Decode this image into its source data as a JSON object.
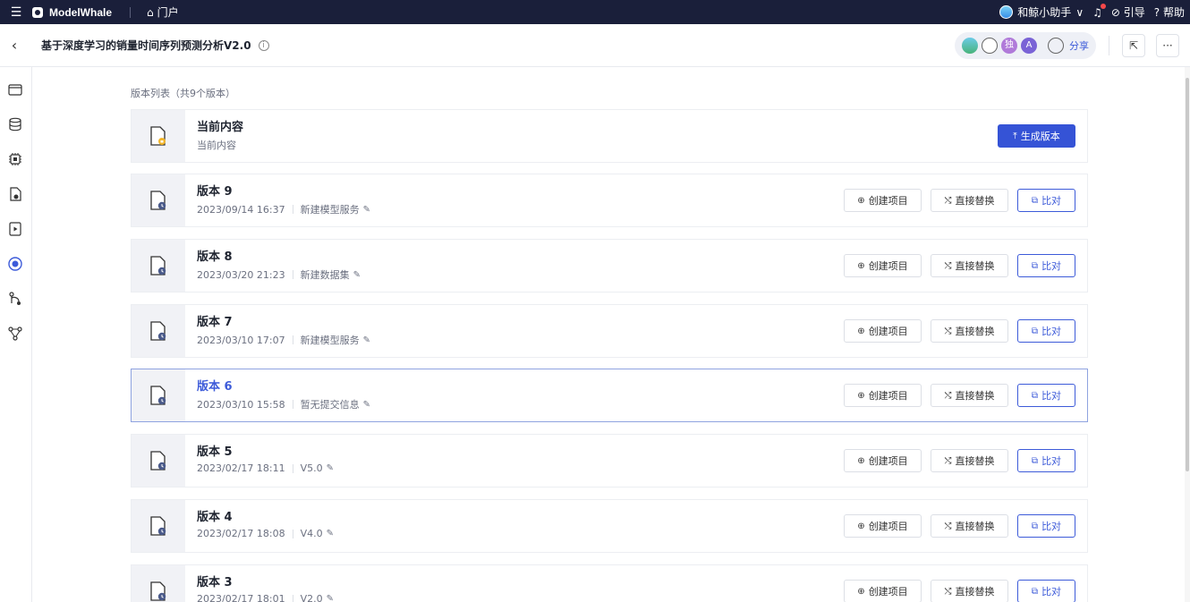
{
  "topbar": {
    "brand": "ModelWhale",
    "portal": "门户",
    "assistant": "和鲸小助手",
    "guide": "引导",
    "help": "帮助"
  },
  "header": {
    "title": "基于深度学习的销量时间序列预测分析V2.0",
    "collab_badge_1": "独",
    "collab_badge_2": "A",
    "share": "分享",
    "more": "···"
  },
  "list": {
    "title": "版本列表（共9个版本）",
    "current": {
      "name": "当前内容",
      "sub": "当前内容",
      "action": "生成版本"
    },
    "actions": {
      "create": "创建项目",
      "replace": "直接替换",
      "compare": "比对"
    },
    "versions": [
      {
        "name": "版本 9",
        "date": "2023/09/14 16:37",
        "note": "新建模型服务"
      },
      {
        "name": "版本 8",
        "date": "2023/03/20 21:23",
        "note": "新建数据集"
      },
      {
        "name": "版本 7",
        "date": "2023/03/10 17:07",
        "note": "新建模型服务"
      },
      {
        "name": "版本 6",
        "date": "2023/03/10 15:58",
        "note": "暂无提交信息"
      },
      {
        "name": "版本 5",
        "date": "2023/02/17 18:11",
        "note": "V5.0"
      },
      {
        "name": "版本 4",
        "date": "2023/02/17 18:08",
        "note": "V4.0"
      },
      {
        "name": "版本 3",
        "date": "2023/02/17 18:01",
        "note": "V2.0"
      }
    ]
  },
  "colors": {
    "topbar_bg": "#1a1f3a",
    "primary": "#3553d6",
    "active_border": "#8fa3e0"
  }
}
